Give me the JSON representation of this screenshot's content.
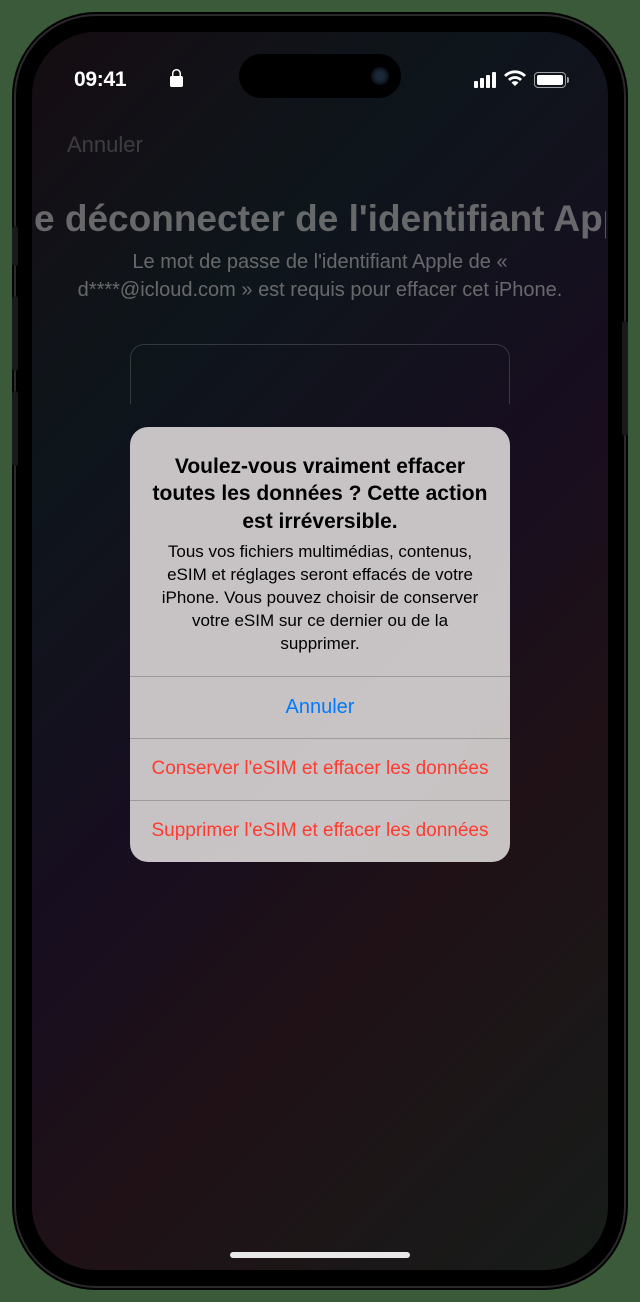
{
  "status": {
    "time": "09:41"
  },
  "background": {
    "cancel": "Annuler",
    "title": "e déconnecter de l'identifiant App",
    "subtitle": "Le mot de passe de l'identifiant Apple de « d****@icloud.com » est requis pour effacer cet iPhone."
  },
  "alert": {
    "title": "Voulez-vous vraiment effacer toutes les données ? Cette action est irréversible.",
    "message": "Tous vos fichiers multimédias, contenus, eSIM et réglages seront effacés de votre iPhone. Vous pouvez choisir de conserver votre eSIM sur ce dernier ou de la supprimer.",
    "cancel": "Annuler",
    "keep_esim": "Conserver l'eSIM et effacer les données",
    "delete_esim": "Supprimer l'eSIM et effacer les données"
  }
}
